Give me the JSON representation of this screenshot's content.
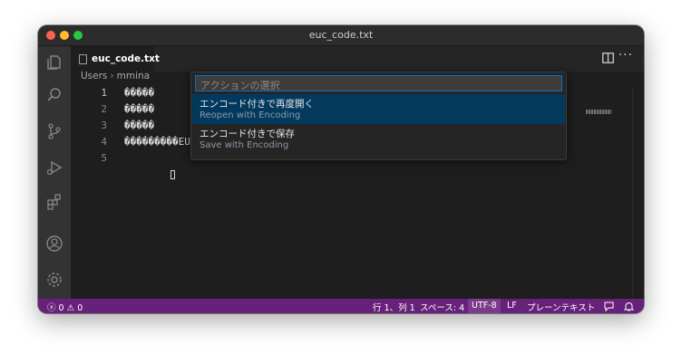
{
  "window": {
    "title": "euc_code.txt"
  },
  "tab": {
    "label": "euc_code.txt"
  },
  "breadcrumb": {
    "parts": [
      "Users",
      "mmina"
    ]
  },
  "editor": {
    "line_numbers": [
      "1",
      "2",
      "3",
      "4",
      "5"
    ],
    "lines": [
      "\u0000\u0000\u0000\u0000\u0000",
      "\u0000\u0000\u0000\u0000\u0000",
      "\u0000\u0000\u0000\u0000\u0000",
      "\u0000\u0000\u0000\u0000\u0000\u0000\u0000\u0000\u0000EUC\u0000\u0000\u0000\u0000\u0000ɣYp\u0000\u0000\u0000\u0000ʒt\u0000\u0000\u0000\u0000\u0000G\u0000\u0000\u0000",
      ""
    ]
  },
  "quickpick": {
    "placeholder": "アクションの選択",
    "items": [
      {
        "title": "エンコード付きで再度開く",
        "subtitle": "Reopen with Encoding",
        "selected": true
      },
      {
        "title": "エンコード付きで保存",
        "subtitle": "Save with Encoding",
        "selected": false
      }
    ]
  },
  "statusbar": {
    "errors": "0",
    "warnings": "0",
    "position": "行 1、列 1",
    "spaces": "スペース: 4",
    "encoding": "UTF-8",
    "eol": "LF",
    "language": "プレーンテキスト"
  },
  "colors": {
    "statusbar": "#68217a",
    "selection": "#04395e",
    "focus_border": "#0e70c0"
  }
}
